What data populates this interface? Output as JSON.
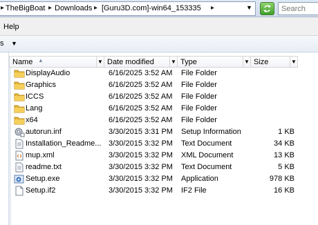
{
  "address": {
    "crumbs": [
      "TheBigBoat",
      "Downloads",
      "[Guru3D.com]-win64_153335"
    ],
    "search_placeholder": "Search"
  },
  "menu": {
    "help": "Help"
  },
  "toolbar": {
    "organize_fragment": "s"
  },
  "columns": {
    "name": "Name",
    "date": "Date modified",
    "type": "Type",
    "size": "Size"
  },
  "files": [
    {
      "name": "DisplayAudio",
      "date": "6/16/2025 3:52 AM",
      "type": "File Folder",
      "size": "",
      "icon": "folder-icon"
    },
    {
      "name": "Graphics",
      "date": "6/16/2025 3:52 AM",
      "type": "File Folder",
      "size": "",
      "icon": "folder-icon"
    },
    {
      "name": "ICCS",
      "date": "6/16/2025 3:52 AM",
      "type": "File Folder",
      "size": "",
      "icon": "folder-icon"
    },
    {
      "name": "Lang",
      "date": "6/16/2025 3:52 AM",
      "type": "File Folder",
      "size": "",
      "icon": "folder-icon"
    },
    {
      "name": "x64",
      "date": "6/16/2025 3:52 AM",
      "type": "File Folder",
      "size": "",
      "icon": "folder-icon"
    },
    {
      "name": "autorun.inf",
      "date": "3/30/2015 3:31 PM",
      "type": "Setup Information",
      "size": "1 KB",
      "icon": "setup-info-icon"
    },
    {
      "name": "Installation_Readme...",
      "date": "3/30/2015 3:32 PM",
      "type": "Text Document",
      "size": "34 KB",
      "icon": "text-document-icon"
    },
    {
      "name": "mup.xml",
      "date": "3/30/2015 3:32 PM",
      "type": "XML Document",
      "size": "13 KB",
      "icon": "xml-document-icon"
    },
    {
      "name": "readme.txt",
      "date": "3/30/2015 3:32 PM",
      "type": "Text Document",
      "size": "5 KB",
      "icon": "text-document-icon"
    },
    {
      "name": "Setup.exe",
      "date": "3/30/2015 3:32 PM",
      "type": "Application",
      "size": "978 KB",
      "icon": "application-icon"
    },
    {
      "name": "Setup.if2",
      "date": "3/30/2015 3:32 PM",
      "type": "IF2 File",
      "size": "16 KB",
      "icon": "generic-file-icon"
    }
  ],
  "colors": {
    "folder": "#e8b935",
    "refresh": "#4aa832",
    "header_bg": "#f1f3f6"
  }
}
